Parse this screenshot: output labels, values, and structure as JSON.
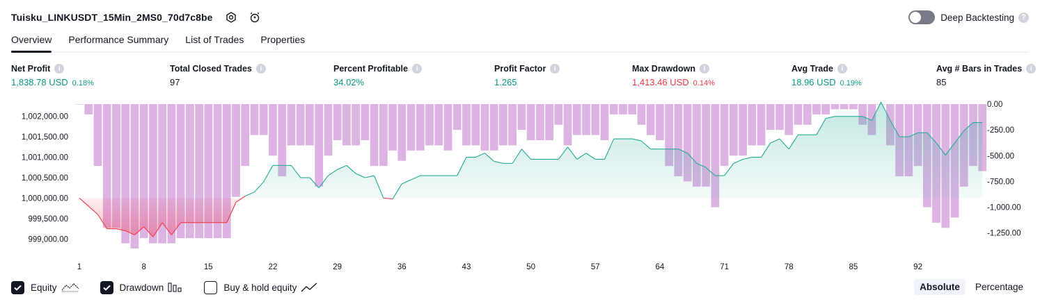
{
  "header": {
    "title": "Tuisku_LINKUSDT_15Min_2MS0_70d7c8be",
    "deep_backtesting_label": "Deep Backtesting",
    "help_symbol": "?"
  },
  "tabs": [
    {
      "label": "Overview",
      "active": true
    },
    {
      "label": "Performance Summary",
      "active": false
    },
    {
      "label": "List of Trades",
      "active": false
    },
    {
      "label": "Properties",
      "active": false
    }
  ],
  "info_symbol": "i",
  "stats": [
    {
      "label": "Net Profit",
      "value": "1,838.78 USD",
      "pct": "0.18%",
      "color": "green"
    },
    {
      "label": "Total Closed Trades",
      "value": "97",
      "pct": "",
      "color": "dark"
    },
    {
      "label": "Percent Profitable",
      "value": "34.02%",
      "pct": "",
      "color": "green"
    },
    {
      "label": "Profit Factor",
      "value": "1.265",
      "pct": "",
      "color": "green"
    },
    {
      "label": "Max Drawdown",
      "value": "1,413.46 USD",
      "pct": "0.14%",
      "color": "red"
    },
    {
      "label": "Avg Trade",
      "value": "18.96 USD",
      "pct": "0.19%",
      "color": "green"
    },
    {
      "label": "Avg # Bars in Trades",
      "value": "85",
      "pct": "",
      "color": "dark"
    }
  ],
  "chart_data": {
    "type": "line",
    "x_tick_labels": [
      "1",
      "8",
      "15",
      "22",
      "29",
      "36",
      "43",
      "50",
      "57",
      "64",
      "71",
      "78",
      "85",
      "92"
    ],
    "x_ticks": [
      1,
      8,
      15,
      22,
      29,
      36,
      43,
      50,
      57,
      64,
      71,
      78,
      85,
      92
    ],
    "xlim": [
      1,
      98
    ],
    "left_axis": {
      "ylim": [
        998700,
        1002300
      ],
      "ticks": [
        999000,
        999500,
        1000000,
        1000500,
        1001000,
        1001500,
        1002000
      ],
      "tick_labels": [
        "999,000.00",
        "999,500.00",
        "1,000,000.00",
        "1,000,500.00",
        "1,001,000.00",
        "1,001,500.00",
        "1,002,000.00"
      ],
      "baseline": 1000000
    },
    "right_axis": {
      "ylim": [
        -1413.46,
        0
      ],
      "ticks": [
        0,
        -250,
        -500,
        -750,
        -1000,
        -1250
      ],
      "tick_labels": [
        "0.00",
        "-250.00",
        "-500.00",
        "-750.00",
        "-1,000.00",
        "-1,250.00"
      ]
    },
    "series": [
      {
        "name": "Equity",
        "color_up": "#22ab94",
        "color_down": "#f23645",
        "values": [
          1000000,
          999800,
          999600,
          999250,
          999250,
          999200,
          999100,
          999300,
          999050,
          999400,
          999100,
          999400,
          999400,
          999400,
          999400,
          999400,
          999400,
          999900,
          1000050,
          1000150,
          1000400,
          1000800,
          1000800,
          1000800,
          1000500,
          1000500,
          1000250,
          1000550,
          1000700,
          1000800,
          1000600,
          1000500,
          1000550,
          1000000,
          999980,
          1000350,
          1000450,
          1000550,
          1000550,
          1000550,
          1000550,
          1000550,
          1001000,
          1001000,
          1001100,
          1000900,
          1000850,
          1000850,
          1001200,
          1000950,
          1000950,
          1000950,
          1000950,
          1001250,
          1000950,
          1001100,
          1000950,
          1000950,
          1001450,
          1001450,
          1001450,
          1001400,
          1001200,
          1001200,
          1001200,
          1001200,
          1001100,
          1000850,
          1000750,
          1000550,
          1000550,
          1000850,
          1000950,
          1001000,
          1001000,
          1001350,
          1001450,
          1001200,
          1001550,
          1001550,
          1001550,
          1001950,
          1002000,
          1002000,
          1002000,
          1002000,
          1001900,
          1002350,
          1001900,
          1001500,
          1001500,
          1001600,
          1001600,
          1001350,
          1001050,
          1001350,
          1001650,
          1001850,
          1001850
        ]
      },
      {
        "name": "Drawdown",
        "color": "#ce93d8",
        "values": [
          0,
          -0.1,
          -0.6,
          -1.2,
          -1.2,
          -1.35,
          -1.4,
          -1.3,
          -1.35,
          -1.35,
          -1.35,
          -1.3,
          -1.3,
          -1.3,
          -1.3,
          -1.3,
          -1.3,
          -0.9,
          -0.6,
          -0.3,
          -0.3,
          -0.5,
          -0.7,
          -0.4,
          -0.4,
          -0.4,
          -0.8,
          -0.5,
          -0.35,
          -0.4,
          -0.4,
          -0.35,
          -0.6,
          -0.6,
          -0.45,
          -0.55,
          -0.45,
          -0.45,
          -0.4,
          -0.4,
          -0.45,
          -0.25,
          -0.4,
          -0.4,
          -0.45,
          -0.45,
          -0.4,
          -0.4,
          -0.25,
          -0.35,
          -0.35,
          -0.35,
          -0.2,
          -0.4,
          -0.3,
          -0.3,
          -0.3,
          -0.35,
          -0.1,
          -0.1,
          -0.1,
          -0.2,
          -0.3,
          -0.35,
          -0.6,
          -0.7,
          -0.75,
          -0.8,
          -0.8,
          -1.0,
          -0.6,
          -0.5,
          -0.5,
          -0.4,
          -0.4,
          -0.25,
          -0.25,
          -0.3,
          -0.2,
          -0.2,
          -0.1,
          -0.1,
          -0.05,
          -0.05,
          -0.05,
          -0.2,
          -0.3,
          0,
          -0.4,
          -0.7,
          -0.7,
          -0.6,
          -1.0,
          -1.15,
          -1.2,
          -1.1,
          -0.8,
          -0.6,
          -0.65
        ]
      },
      {
        "name": "Buy & hold equity",
        "values": []
      }
    ]
  },
  "footer": {
    "checkboxes": [
      {
        "label": "Equity",
        "checked": true,
        "icon": "equity-line-icon"
      },
      {
        "label": "Drawdown",
        "checked": true,
        "icon": "drawdown-bars-icon"
      },
      {
        "label": "Buy & hold equity",
        "checked": false,
        "icon": "buy-hold-line-icon"
      }
    ],
    "segments": [
      {
        "label": "Absolute",
        "active": true
      },
      {
        "label": "Percentage",
        "active": false
      }
    ]
  }
}
